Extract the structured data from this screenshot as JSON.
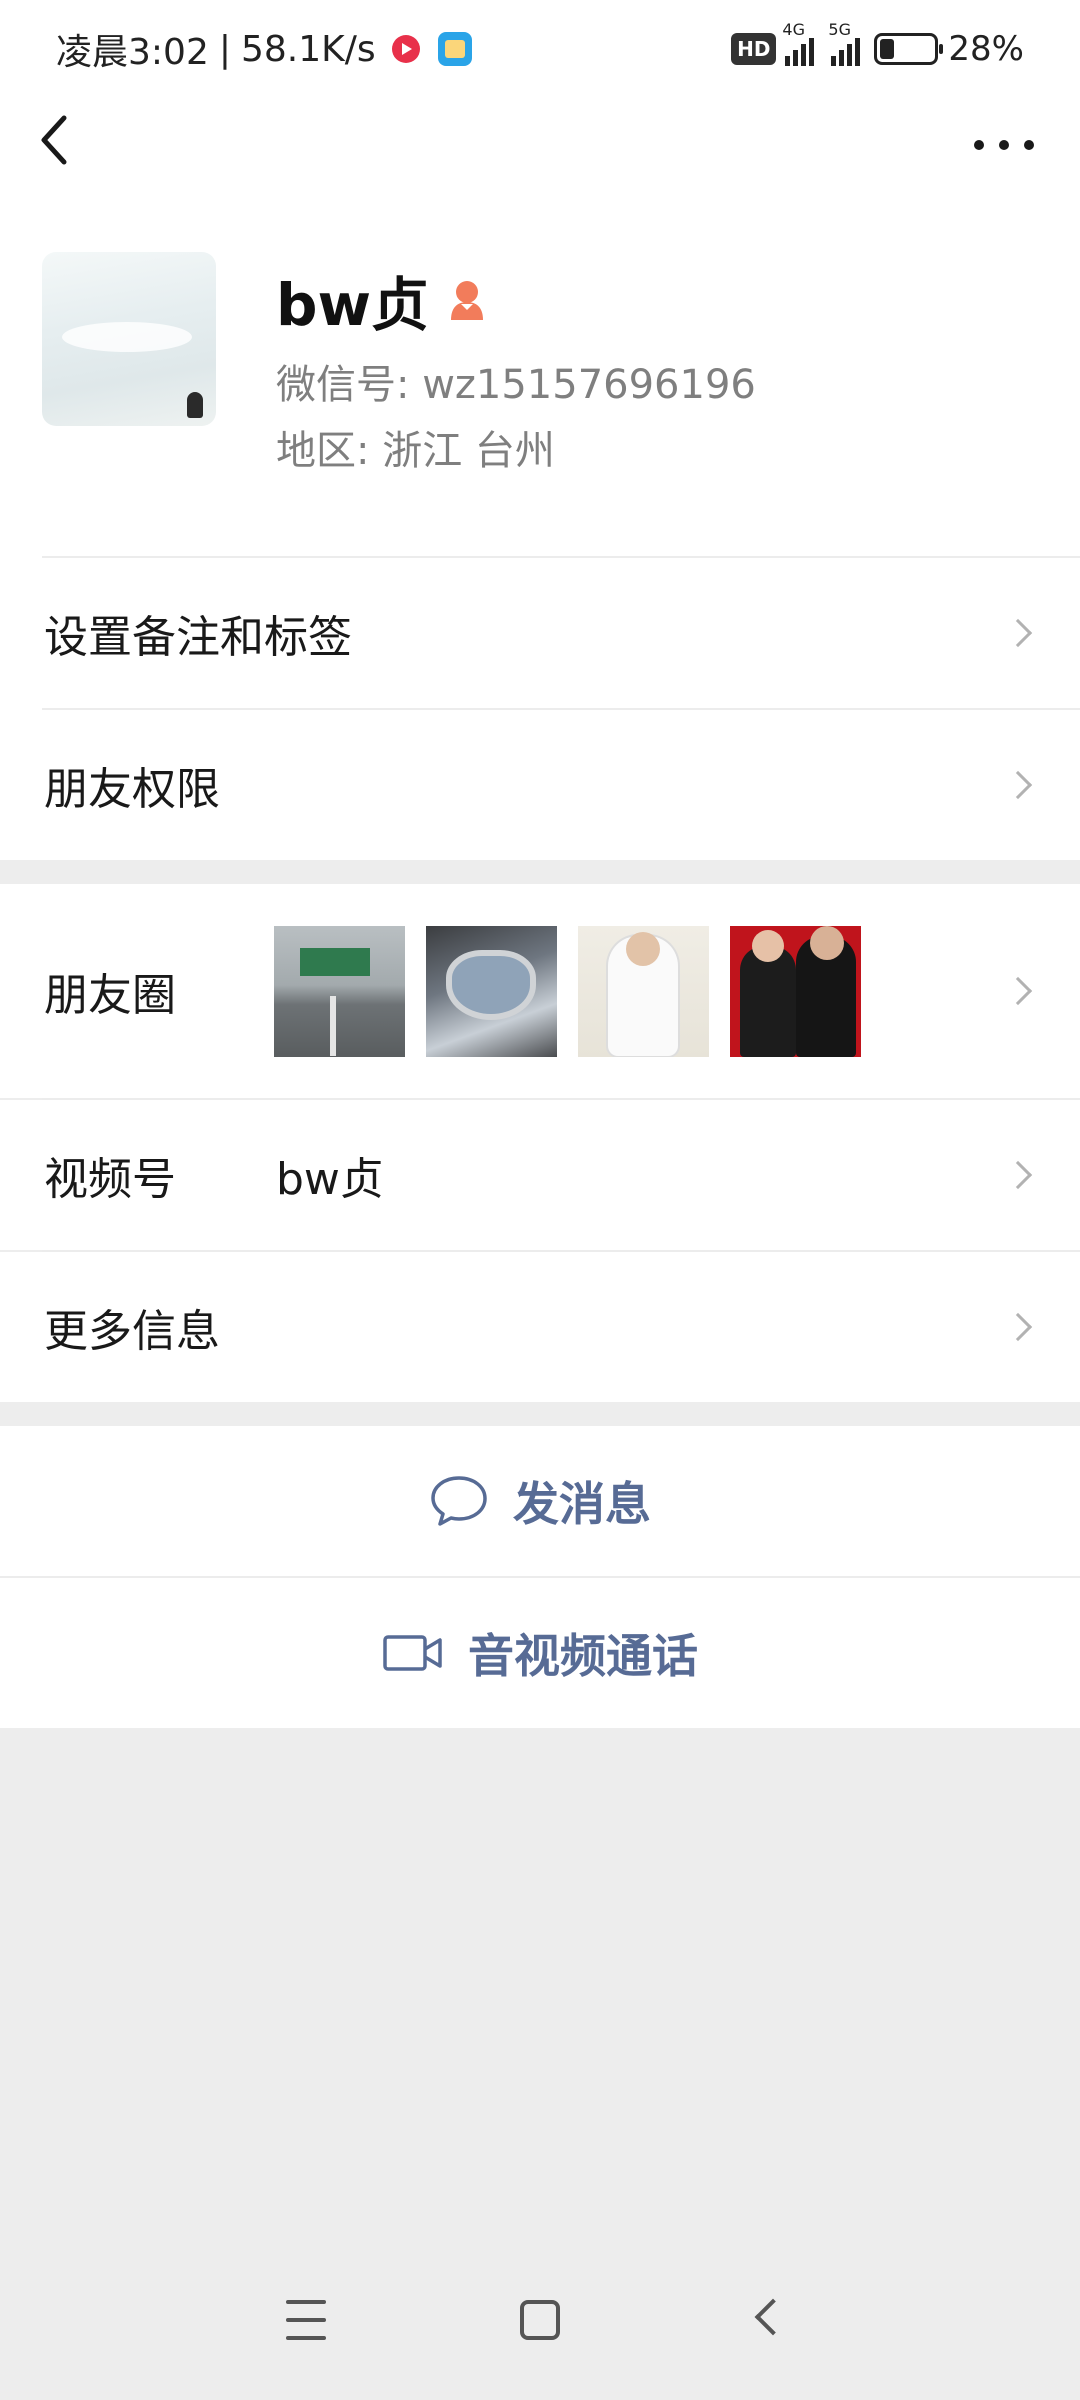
{
  "status_bar": {
    "time": "凌晨3:02",
    "network_speed": "58.1K/s",
    "hd_badge": "HD",
    "network_1": "4G",
    "network_2": "5G",
    "battery": "28%"
  },
  "profile": {
    "nickname": "bw贞",
    "wechat_id": "微信号:  wz15157696196",
    "region": "地区:  浙江   台州"
  },
  "menu": {
    "set_remark": "设置备注和标签",
    "friend_permissions": "朋友权限",
    "moments": "朋友圈",
    "channels": "视频号",
    "channels_value": "bw贞",
    "more_info": "更多信息"
  },
  "actions": {
    "send_message": "发消息",
    "video_call": "音视频通话"
  },
  "colors": {
    "accent_link": "#576b95",
    "background": "#ededed",
    "gender_icon": "#f27c5b"
  },
  "icons": {
    "back": "chevron-left-icon",
    "more": "more-dots-icon",
    "gender": "female-icon",
    "message": "chat-bubble-icon",
    "video": "video-camera-icon"
  }
}
